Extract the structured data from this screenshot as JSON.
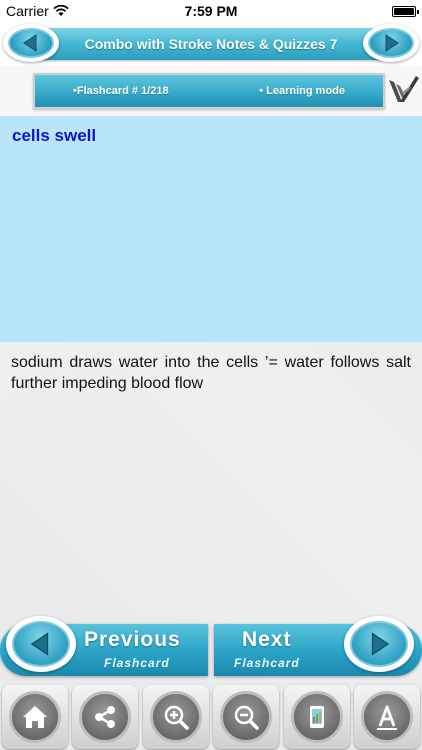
{
  "status_bar": {
    "carrier": "Carrier",
    "time": "7:59 PM"
  },
  "header": {
    "title": "Combo with Stroke Notes & Quizzes 7"
  },
  "info_bar": {
    "flashcard_label": "•Flashcard #  1/218",
    "mode_label": "• Learning mode"
  },
  "card": {
    "question": "cells swell",
    "answer": "sodium draws water into the cells ’= water follows salt further impeding blood flow"
  },
  "navigation": {
    "previous_label": "Previous",
    "previous_sub": "Flashcard",
    "next_label": "Next",
    "next_sub": "Flashcard"
  },
  "toolbar": {
    "items": [
      "home-icon",
      "share-icon",
      "zoom-in-icon",
      "zoom-out-icon",
      "phone-icon",
      "font-icon"
    ]
  },
  "colors": {
    "accent": "#36aac9",
    "question_bg": "#b8e6f8",
    "question_text": "#1414c8"
  }
}
